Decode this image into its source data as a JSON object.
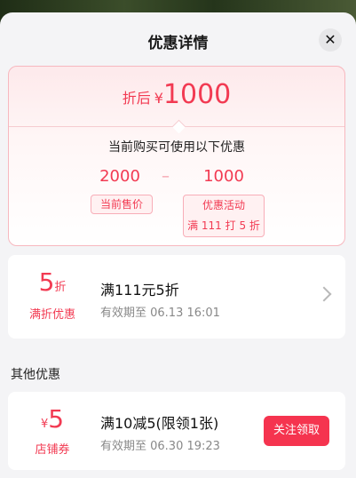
{
  "sheet": {
    "title": "优惠详情"
  },
  "summary": {
    "final_label": "折后",
    "currency": "¥",
    "final_price": "1000",
    "available_text": "当前购买可使用以下优惠",
    "original_price": "2000",
    "dash": "–",
    "discount_amount": "1000",
    "original_tag": "当前售价",
    "discount_tag_line1": "优惠活动",
    "discount_tag_line2": "满 111 打 5 折"
  },
  "coupon_main": {
    "amount": "5",
    "unit": "折",
    "type": "满折优惠",
    "name": "满111元5折",
    "valid": "有效期至 06.13 16:01"
  },
  "other_section_title": "其他优惠",
  "coupon_other": {
    "currency": "¥",
    "amount": "5",
    "type": "店铺券",
    "name": "满10减5(限领1张)",
    "valid": "有效期至 06.30 19:23",
    "button_label": "关注领取"
  },
  "colors": {
    "accent": "#f23a52",
    "button": "#f5344f",
    "border": "#f7b8bf"
  }
}
